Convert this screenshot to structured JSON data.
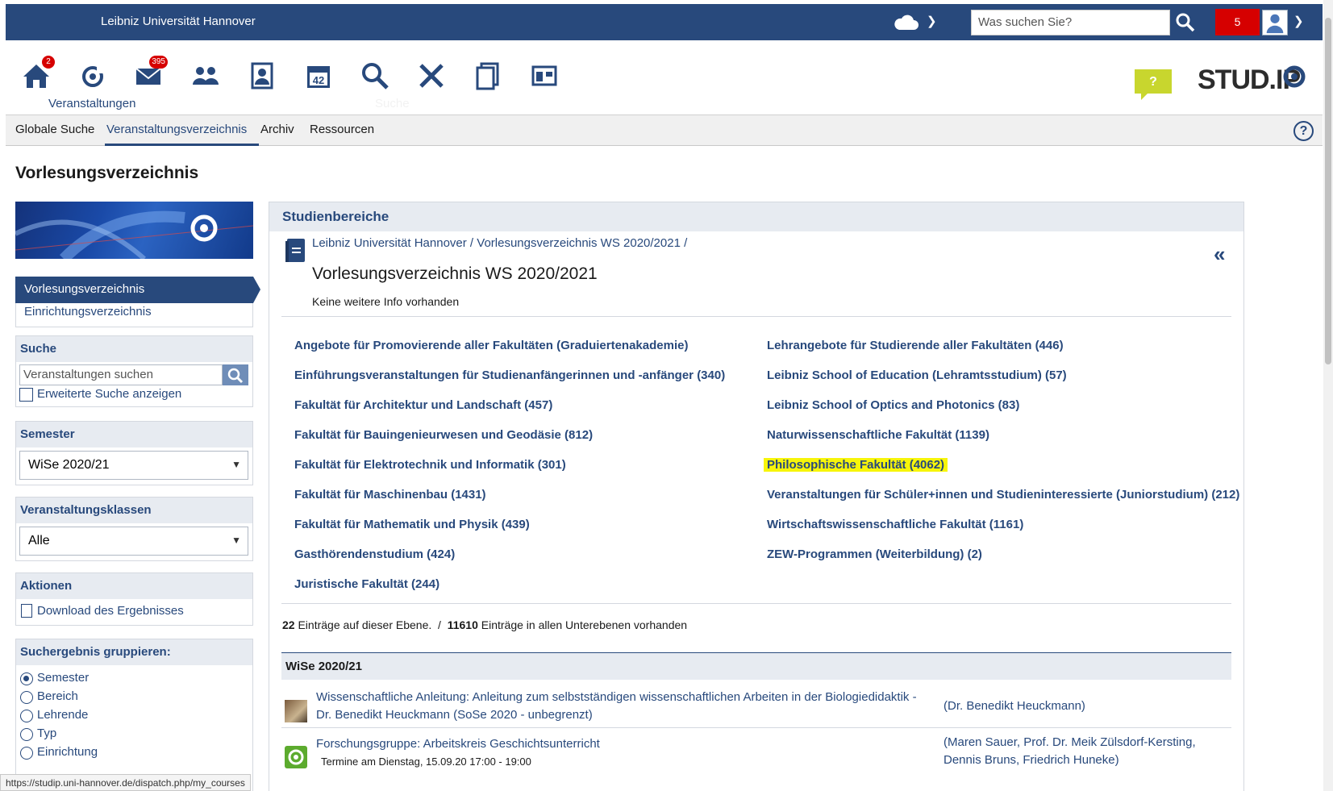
{
  "topbar": {
    "university": "Leibniz Universität Hannover",
    "search_placeholder": "Was suchen Sie?",
    "notification_count": "5"
  },
  "iconnav": {
    "items": [
      {
        "icon": "home-icon",
        "badge": "2"
      },
      {
        "icon": "courses-icon",
        "label": "Veranstaltungen"
      },
      {
        "icon": "messages-icon",
        "badge": "395"
      },
      {
        "icon": "community-icon"
      },
      {
        "icon": "profile-icon"
      },
      {
        "icon": "calendar-icon"
      },
      {
        "icon": "search-icon",
        "label": "Suche"
      },
      {
        "icon": "tools-icon"
      },
      {
        "icon": "files-icon"
      },
      {
        "icon": "admin-icon"
      }
    ],
    "logo": "STUD.IP"
  },
  "tabs": {
    "items": [
      "Globale Suche",
      "Veranstaltungsverzeichnis",
      "Archiv",
      "Ressourcen"
    ],
    "help": "?"
  },
  "page_title": "Vorlesungsverzeichnis",
  "sidebar": {
    "nav": [
      "Vorlesungsverzeichnis",
      "Einrichtungsverzeichnis"
    ],
    "search": {
      "title": "Suche",
      "placeholder": "Veranstaltungen suchen",
      "advanced": "Erweiterte Suche anzeigen"
    },
    "semester": {
      "title": "Semester",
      "value": "WiSe 2020/21"
    },
    "classes": {
      "title": "Veranstaltungsklassen",
      "value": "Alle"
    },
    "actions": {
      "title": "Aktionen",
      "download": "Download des Ergebnisses"
    },
    "group": {
      "title": "Suchergebnis gruppieren:",
      "options": [
        "Semester",
        "Bereich",
        "Lehrende",
        "Typ",
        "Einrichtung"
      ],
      "selected": "Semester"
    }
  },
  "main": {
    "title": "Studienbereiche",
    "breadcrumb": "Leibniz Universität Hannover / Vorlesungsverzeichnis WS 2020/2021 /",
    "heading": "Vorlesungsverzeichnis WS 2020/2021",
    "info": "Keine weitere Info vorhanden",
    "categories_left": [
      "Angebote für Promovierende aller Fakultäten (Graduiertenakademie)",
      "Einführungsveranstaltungen für Studienanfängerinnen und -anfänger (340)",
      "Fakultät für Architektur und Landschaft (457)",
      "Fakultät für Bauingenieurwesen und Geodäsie (812)",
      "Fakultät für Elektrotechnik und Informatik (301)",
      "Fakultät für Maschinenbau (1431)",
      "Fakultät für Mathematik und Physik (439)",
      "Gasthörendenstudium (424)",
      "Juristische Fakultät (244)"
    ],
    "categories_right": [
      "Lehrangebote für Studierende aller Fakultäten (446)",
      "Leibniz School of Education (Lehramtsstudium) (57)",
      "Leibniz School of Optics and Photonics (83)",
      "Naturwissenschaftliche Fakultät (1139)",
      "Philosophische Fakultät (4062)",
      "Veranstaltungen für Schüler+innen und Studieninteressierte (Juniorstudium) (212)",
      "Wirtschaftswissenschaftliche Fakultät (1161)",
      "ZEW-Programmen (Weiterbildung) (2)"
    ],
    "highlight_color": "#f7f50a",
    "count_entries": "22",
    "count_entries_text": "Einträge auf dieser Ebene.",
    "count_separator": "/",
    "count_all": "11610",
    "count_all_text": "Einträge in allen Unterebenen vorhanden",
    "semester_head": "WiSe 2020/21",
    "courses": [
      {
        "title_line1": "Wissenschaftliche Anleitung: Anleitung zum selbstständigen wissenschaftlichen Arbeiten in der Biologiedidaktik -",
        "title_line2": "Dr. Benedikt Heuckmann (SoSe 2020 - unbegrenzt)",
        "lecturers": "(Dr. Benedikt Heuckmann)"
      },
      {
        "title_line1": "Forschungsgruppe: Arbeitskreis Geschichtsunterricht",
        "subtitle": "Termine am Dienstag, 15.09.20 17:00 - 19:00",
        "lecturers_line1": "(Maren Sauer, Prof. Dr. Meik Zülsdorf-Kersting,",
        "lecturers_line2": "Dennis Bruns, Friedrich Huneke)"
      }
    ]
  },
  "statusbar": "https://studip.uni-hannover.de/dispatch.php/my_courses",
  "colors": {
    "primary": "#28497c",
    "badge": "#d60000",
    "panel_head": "#e7ebf1"
  }
}
